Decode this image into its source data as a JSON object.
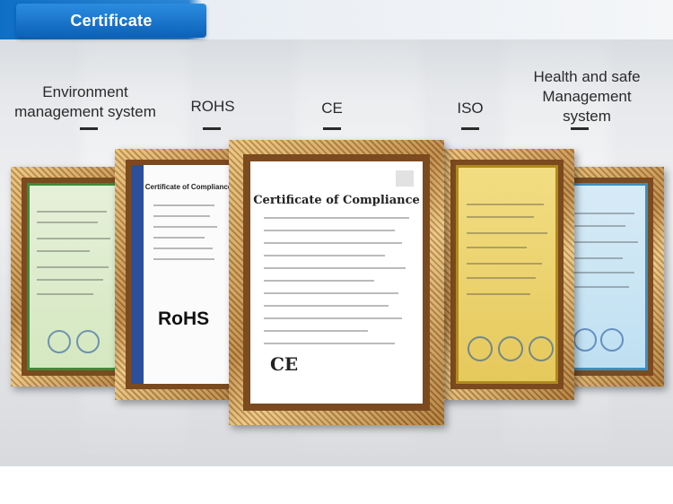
{
  "header": {
    "title": "Certificate"
  },
  "labels": [
    {
      "id": "env",
      "lines": [
        "Environment",
        "management system"
      ]
    },
    {
      "id": "rohs",
      "lines": [
        "ROHS"
      ]
    },
    {
      "id": "ce",
      "lines": [
        "CE"
      ]
    },
    {
      "id": "iso",
      "lines": [
        "ISO"
      ]
    },
    {
      "id": "health",
      "lines": [
        "Health and safe",
        "Management",
        "system"
      ]
    }
  ],
  "certificates": {
    "rohs_mark": "RoHS",
    "ce_title": "Certificate of Compliance",
    "ce_mark": "CE",
    "rohs_title": "Certificate of Compliance"
  }
}
